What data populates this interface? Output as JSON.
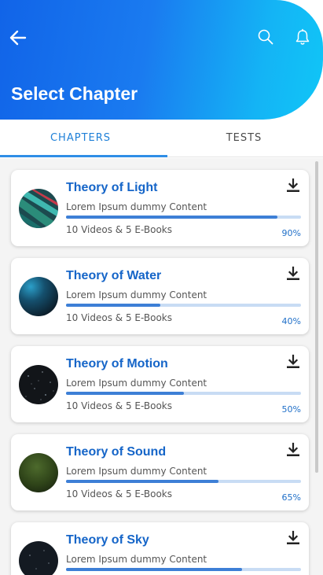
{
  "header": {
    "title": "Select Chapter",
    "gradient_start": "#1164e8",
    "gradient_end": "#10c6f7",
    "icons": [
      "back-arrow-icon",
      "search-icon",
      "bell-icon"
    ]
  },
  "tabs": [
    {
      "label": "CHAPTERS",
      "active": true
    },
    {
      "label": "TESTS",
      "active": false
    }
  ],
  "chapters": [
    {
      "title": "Theory of Light",
      "description": "Lorem Ipsum dummy Content",
      "meta": "10 Videos & 5 E-Books",
      "percent_label": "90%",
      "progress": 0.9
    },
    {
      "title": "Theory of Water",
      "description": "Lorem Ipsum dummy Content",
      "meta": "10 Videos & 5 E-Books",
      "percent_label": "40%",
      "progress": 0.4
    },
    {
      "title": "Theory of Motion",
      "description": "Lorem Ipsum dummy Content",
      "meta": "10 Videos & 5 E-Books",
      "percent_label": "50%",
      "progress": 0.5
    },
    {
      "title": "Theory of Sound",
      "description": "Lorem Ipsum dummy Content",
      "meta": "10 Videos & 5 E-Books",
      "percent_label": "65%",
      "progress": 0.65
    },
    {
      "title": "Theory of Sky",
      "description": "Lorem Ipsum dummy Content",
      "meta": "",
      "percent_label": "",
      "progress": 0.75
    }
  ],
  "colors": {
    "accent": "#1f80d8",
    "title_blue": "#1565c8",
    "progress_fill": "#3d7fd6",
    "progress_track": "#c8dcf4"
  }
}
